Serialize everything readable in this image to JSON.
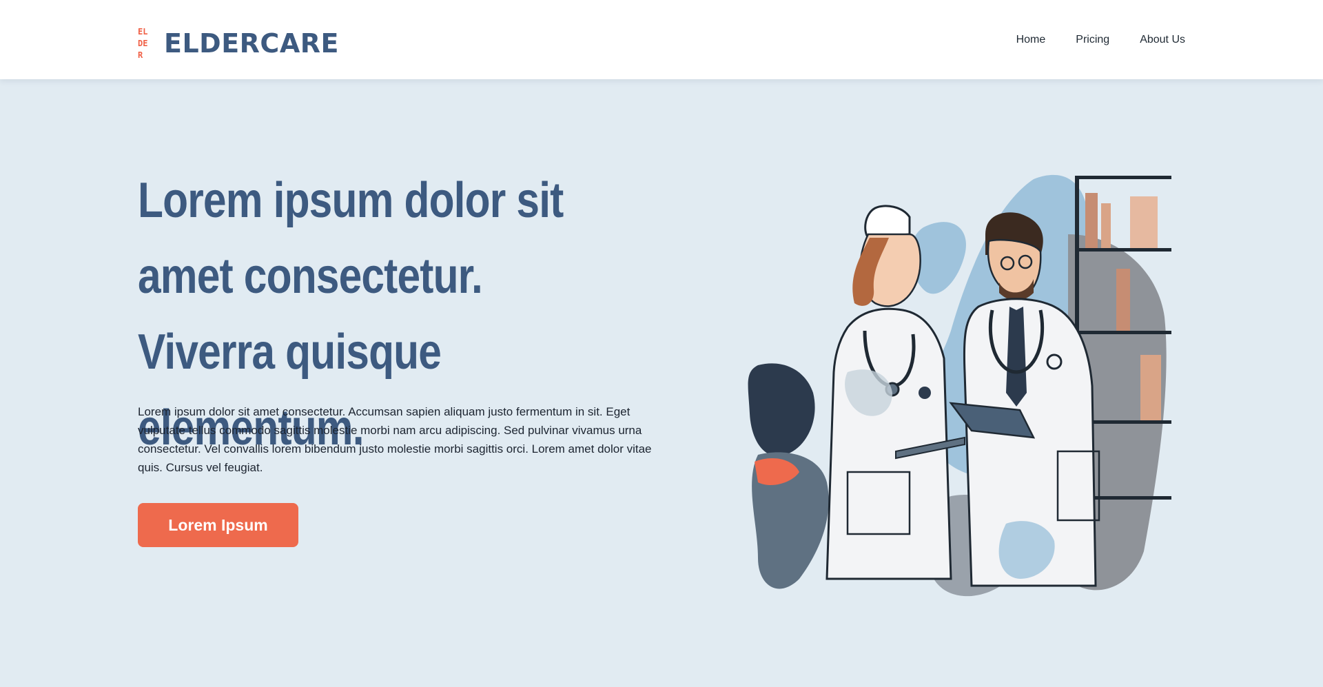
{
  "header": {
    "logo_mark": [
      "EL",
      "DE",
      "R"
    ],
    "logo_text": "ELDERCARE",
    "nav": [
      "Home",
      "Pricing",
      "About Us"
    ]
  },
  "hero": {
    "title": "Lorem ipsum dolor sit amet consectetur. Viverra quisque elementum.",
    "body": "Lorem ipsum dolor sit amet consectetur. Accumsan sapien aliquam justo fermentum in sit. Eget vulputate tellus commodo sagittis molestie morbi nam arcu adipiscing. Sed pulvinar vivamus urna consectetur. Vel convallis  lorem bibendum justo molestie morbi sagittis orci. Lorem amet dolor vitae quis. Cursus vel feugiat.",
    "cta_label": "Lorem Ipsum"
  },
  "colors": {
    "brand": "#3d5a80",
    "accent": "#ee6a4d",
    "background": "#e1ebf2"
  },
  "illustration": {
    "icon": "doctors-illustration"
  }
}
